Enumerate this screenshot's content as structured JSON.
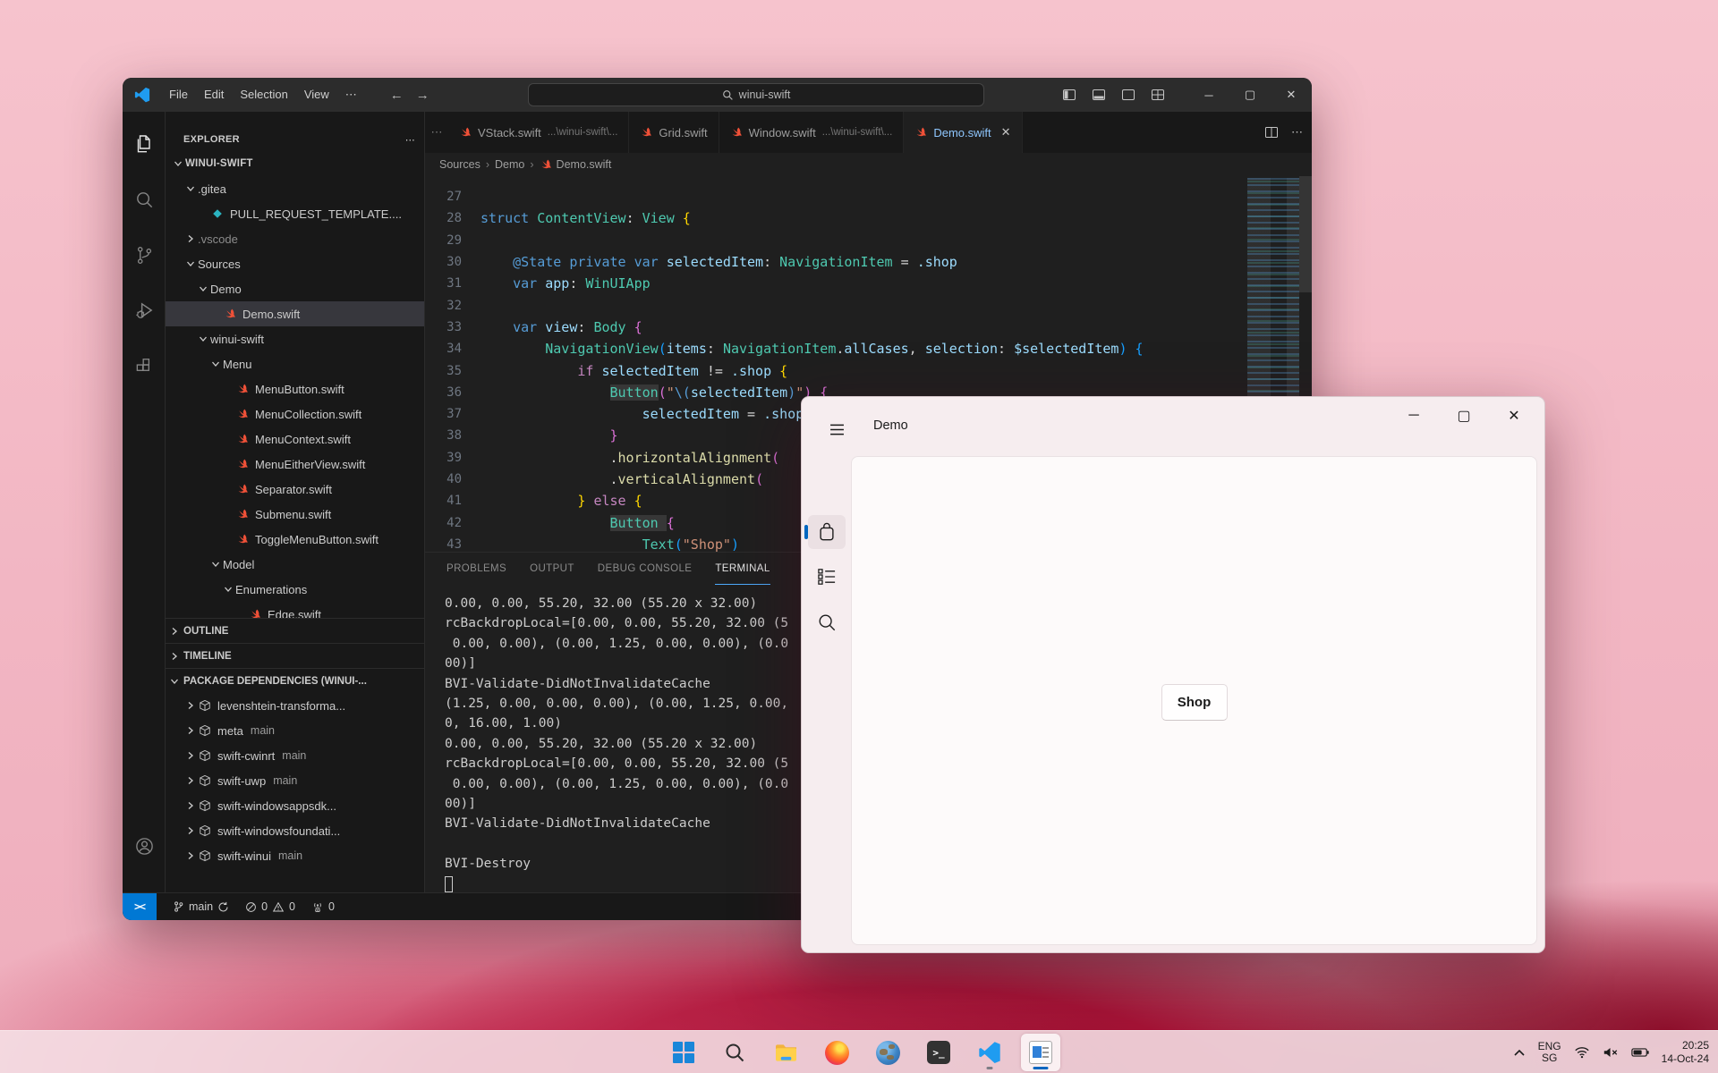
{
  "vscode": {
    "titlebar": {
      "menus": [
        "File",
        "Edit",
        "Selection",
        "View"
      ],
      "menu_more": "⋯",
      "back": "←",
      "forward": "→",
      "search_value": "winui-swift",
      "minimize": "─",
      "maximize": "▢",
      "close": "✕"
    },
    "tabs": [
      {
        "label": "VStack.swift",
        "desc": "...\\winui-swift\\...",
        "active": false
      },
      {
        "label": "Grid.swift",
        "desc": "",
        "active": false
      },
      {
        "label": "Window.swift",
        "desc": "...\\winui-swift\\...",
        "active": false
      },
      {
        "label": "Demo.swift",
        "desc": "",
        "active": true,
        "close": "✕"
      }
    ],
    "tab_overflow": "⋯",
    "breadcrumb": [
      "Sources",
      "Demo",
      "Demo.swift"
    ],
    "explorer": {
      "header": "EXPLORER",
      "header_more": "⋯",
      "tree": [
        {
          "label": "WINUI-SWIFT",
          "lvl": 0,
          "chev": "down",
          "bold": true
        },
        {
          "label": ".gitea",
          "lvl": 1,
          "chev": "down"
        },
        {
          "label": "PULL_REQUEST_TEMPLATE....",
          "lvl": 2,
          "icon": "diamond"
        },
        {
          "label": ".vscode",
          "lvl": 1,
          "chev": "right",
          "dim": true
        },
        {
          "label": "Sources",
          "lvl": 1,
          "chev": "down"
        },
        {
          "label": "Demo",
          "lvl": 2,
          "chev": "down"
        },
        {
          "label": "Demo.swift",
          "lvl": 3,
          "icon": "swift",
          "selected": true
        },
        {
          "label": "winui-swift",
          "lvl": 2,
          "chev": "down"
        },
        {
          "label": "Menu",
          "lvl": 3,
          "chev": "down"
        },
        {
          "label": "MenuButton.swift",
          "lvl": 4,
          "icon": "swift"
        },
        {
          "label": "MenuCollection.swift",
          "lvl": 4,
          "icon": "swift"
        },
        {
          "label": "MenuContext.swift",
          "lvl": 4,
          "icon": "swift"
        },
        {
          "label": "MenuEitherView.swift",
          "lvl": 4,
          "icon": "swift"
        },
        {
          "label": "Separator.swift",
          "lvl": 4,
          "icon": "swift"
        },
        {
          "label": "Submenu.swift",
          "lvl": 4,
          "icon": "swift"
        },
        {
          "label": "ToggleMenuButton.swift",
          "lvl": 4,
          "icon": "swift"
        },
        {
          "label": "Model",
          "lvl": 3,
          "chev": "down"
        },
        {
          "label": "Enumerations",
          "lvl": 4,
          "chev": "down"
        },
        {
          "label": "Edge.swift",
          "lvl": 5,
          "icon": "swift"
        }
      ],
      "sections": [
        {
          "label": "OUTLINE",
          "chev": "right"
        },
        {
          "label": "TIMELINE",
          "chev": "right"
        },
        {
          "label": "PACKAGE DEPENDENCIES (WINUI-...",
          "chev": "down"
        }
      ],
      "packages": [
        {
          "name": "levenshtein-transforma...",
          "branch": ""
        },
        {
          "name": "meta",
          "branch": "main"
        },
        {
          "name": "swift-cwinrt",
          "branch": "main"
        },
        {
          "name": "swift-uwp",
          "branch": "main"
        },
        {
          "name": "swift-windowsappsdk...",
          "branch": ""
        },
        {
          "name": "swift-windowsfoundati...",
          "branch": ""
        },
        {
          "name": "swift-winui",
          "branch": "main"
        }
      ]
    },
    "editor": {
      "lines": [
        {
          "n": "27",
          "seg": []
        },
        {
          "n": "28",
          "seg": [
            [
              "struct ",
              "kw"
            ],
            [
              "ContentView",
              "ty"
            ],
            [
              ": ",
              "p"
            ],
            [
              "View ",
              "ty"
            ],
            [
              "{",
              "b1"
            ]
          ]
        },
        {
          "n": "29",
          "seg": []
        },
        {
          "n": "30",
          "seg": [
            [
              "    ",
              "p"
            ],
            [
              "@State ",
              "kw"
            ],
            [
              "private ",
              "kw"
            ],
            [
              "var ",
              "kw"
            ],
            [
              "selectedItem",
              "var"
            ],
            [
              ": ",
              "p"
            ],
            [
              "NavigationItem",
              "ty"
            ],
            [
              " = ",
              "p"
            ],
            [
              ".shop",
              "var"
            ]
          ]
        },
        {
          "n": "31",
          "seg": [
            [
              "    ",
              "p"
            ],
            [
              "var ",
              "kw"
            ],
            [
              "app",
              "var"
            ],
            [
              ": ",
              "p"
            ],
            [
              "WinUIApp",
              "ty"
            ]
          ]
        },
        {
          "n": "32",
          "seg": []
        },
        {
          "n": "33",
          "seg": [
            [
              "    ",
              "p"
            ],
            [
              "var ",
              "kw"
            ],
            [
              "view",
              "var"
            ],
            [
              ": ",
              "p"
            ],
            [
              "Body ",
              "ty"
            ],
            [
              "{",
              "b2"
            ]
          ]
        },
        {
          "n": "34",
          "seg": [
            [
              "        ",
              "p"
            ],
            [
              "NavigationView",
              "ty"
            ],
            [
              "(",
              "b3"
            ],
            [
              "items",
              "var"
            ],
            [
              ": ",
              "p"
            ],
            [
              "NavigationItem",
              "ty"
            ],
            [
              ".",
              "p"
            ],
            [
              "allCases",
              "var"
            ],
            [
              ", ",
              "p"
            ],
            [
              "selection",
              "var"
            ],
            [
              ": ",
              "p"
            ],
            [
              "$selectedItem",
              "var"
            ],
            [
              ")",
              "b3"
            ],
            [
              " {",
              "b3"
            ]
          ]
        },
        {
          "n": "35",
          "seg": [
            [
              "            ",
              "p"
            ],
            [
              "if ",
              "ctl"
            ],
            [
              "selectedItem",
              "var"
            ],
            [
              " != ",
              "p"
            ],
            [
              ".shop ",
              "var"
            ],
            [
              "{",
              "b1"
            ]
          ]
        },
        {
          "n": "36",
          "seg": [
            [
              "                ",
              "p"
            ],
            [
              "Button",
              "ty hl"
            ],
            [
              "(",
              "b2"
            ],
            [
              "\"",
              "str"
            ],
            [
              "\\(",
              "kw"
            ],
            [
              "selectedItem",
              "var"
            ],
            [
              ")",
              "kw"
            ],
            [
              "\"",
              "str"
            ],
            [
              ")",
              "b2"
            ],
            [
              " {",
              "b2"
            ]
          ]
        },
        {
          "n": "37",
          "seg": [
            [
              "                    ",
              "p"
            ],
            [
              "selectedItem",
              "var"
            ],
            [
              " = ",
              "p"
            ],
            [
              ".shop",
              "var"
            ]
          ]
        },
        {
          "n": "38",
          "seg": [
            [
              "                ",
              "p"
            ],
            [
              "}",
              "b2"
            ]
          ]
        },
        {
          "n": "39",
          "seg": [
            [
              "                ",
              "p"
            ],
            [
              ".",
              "p"
            ],
            [
              "horizontalAlignment",
              "fn"
            ],
            [
              "(",
              "b2"
            ]
          ]
        },
        {
          "n": "40",
          "seg": [
            [
              "                ",
              "p"
            ],
            [
              ".",
              "p"
            ],
            [
              "verticalAlignment",
              "fn"
            ],
            [
              "(",
              "b2"
            ]
          ]
        },
        {
          "n": "41",
          "seg": [
            [
              "            ",
              "p"
            ],
            [
              "} ",
              "b1"
            ],
            [
              "else ",
              "ctl"
            ],
            [
              "{",
              "b1"
            ]
          ]
        },
        {
          "n": "42",
          "seg": [
            [
              "                ",
              "p"
            ],
            [
              "Button ",
              "ty hl"
            ],
            [
              "{",
              "b2"
            ]
          ]
        },
        {
          "n": "43",
          "seg": [
            [
              "                    ",
              "p"
            ],
            [
              "Text",
              "ty"
            ],
            [
              "(",
              "b3"
            ],
            [
              "\"Shop\"",
              "str"
            ],
            [
              ")",
              "b3"
            ]
          ]
        }
      ]
    },
    "panel": {
      "tabs": [
        "PROBLEMS",
        "OUTPUT",
        "DEBUG CONSOLE",
        "TERMINAL"
      ],
      "active_tab": "TERMINAL",
      "terminal_lines": [
        "0.00, 0.00, 55.20, 32.00 (55.20 x 32.00)",
        "rcBackdropLocal=[0.00, 0.00, 55.20, 32.00 (5",
        " 0.00, 0.00), (0.00, 1.25, 0.00, 0.00), (0.0",
        "00)]",
        "BVI-Validate-DidNotInvalidateCache",
        "(1.25, 0.00, 0.00, 0.00), (0.00, 1.25, 0.00,",
        "0, 16.00, 1.00)",
        "0.00, 0.00, 55.20, 32.00 (55.20 x 32.00)",
        "rcBackdropLocal=[0.00, 0.00, 55.20, 32.00 (5",
        " 0.00, 0.00), (0.00, 1.25, 0.00, 0.00), (0.0",
        "00)]",
        "BVI-Validate-DidNotInvalidateCache",
        "",
        "BVI-Destroy"
      ]
    },
    "statusbar": {
      "remote": "><",
      "branch": "main",
      "errors": "0",
      "warnings": "0",
      "ports": "0"
    }
  },
  "demo_window": {
    "title": "Demo",
    "minimize": "─",
    "maximize": "▢",
    "close": "✕",
    "nav_items": [
      {
        "icon": "bag",
        "selected": true
      },
      {
        "icon": "list",
        "selected": false
      },
      {
        "icon": "search",
        "selected": false
      }
    ],
    "shop_button": "Shop",
    "accent_color": "#0067c0"
  },
  "taskbar": {
    "icons": [
      {
        "name": "start"
      },
      {
        "name": "search"
      },
      {
        "name": "file-explorer"
      },
      {
        "name": "firefox"
      },
      {
        "name": "globe-app"
      },
      {
        "name": "terminal"
      },
      {
        "name": "vscode",
        "running": true
      },
      {
        "name": "demo-app",
        "active": true
      }
    ],
    "tray": {
      "chevron": "^",
      "lang_line1": "ENG",
      "lang_line2": "SG",
      "time": "20:25",
      "date": "14-Oct-24"
    }
  }
}
